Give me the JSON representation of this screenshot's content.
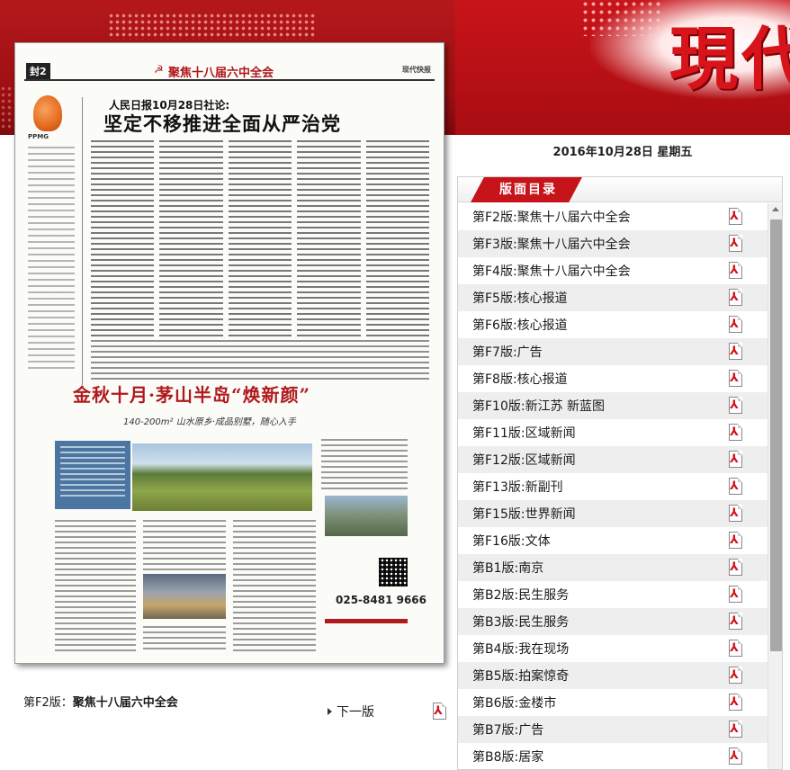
{
  "masthead": "現代",
  "date": "2016年10月28日  星期五",
  "paper": {
    "page_tag": "封2",
    "section_title": "聚焦十八届六中全会",
    "header_meta": "现代快报",
    "ppmg": "PPMG",
    "kicker": "人民日报10月28日社论:",
    "headline": "坚定不移推进全面从严治党",
    "ad_title": "金秋十月·茅山半岛“焕新颜”",
    "ad_sub": "140-200m² 山水原乡·成品别墅，随心入手",
    "ad_phone": "025-8481 9666"
  },
  "caption": {
    "prefix": "第F2版：",
    "title": "聚焦十八届六中全会"
  },
  "pager": {
    "next_label": "下一版"
  },
  "toc": {
    "title": "版面目录",
    "items": [
      "第F2版:聚焦十八届六中全会",
      "第F3版:聚焦十八届六中全会",
      "第F4版:聚焦十八届六中全会",
      "第F5版:核心报道",
      "第F6版:核心报道",
      "第F7版:广告",
      "第F8版:核心报道",
      "第F10版:新江苏 新蓝图",
      "第F11版:区域新闻",
      "第F12版:区域新闻",
      "第F13版:新副刊",
      "第F15版:世界新闻",
      "第F16版:文体",
      "第B1版:南京",
      "第B2版:民生服务",
      "第B3版:民生服务",
      "第B4版:我在现场",
      "第B5版:拍案惊奇",
      "第B6版:金楼市",
      "第B7版:广告",
      "第B8版:居家"
    ]
  },
  "colors": {
    "brand_red": "#c6141a",
    "row_alt": "#eeeeee"
  },
  "icons": {
    "pdf": "pdf-icon",
    "next": "triangle-right-icon"
  }
}
